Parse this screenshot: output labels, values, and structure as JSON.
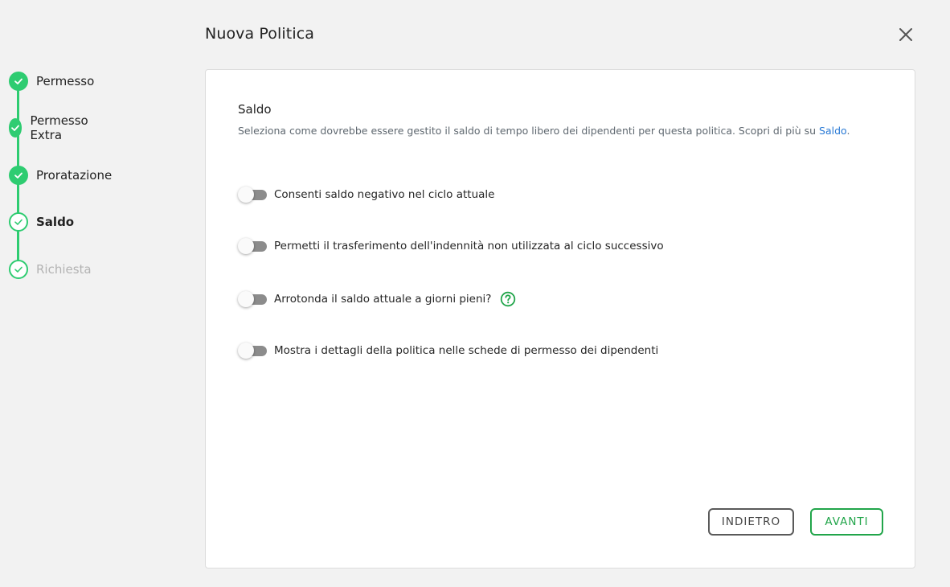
{
  "modal": {
    "title": "Nuova Politica",
    "close_icon": "close-icon"
  },
  "steps": [
    {
      "label": "Permesso",
      "state": "done"
    },
    {
      "label": "Permesso Extra",
      "state": "done"
    },
    {
      "label": "Proratazione",
      "state": "done"
    },
    {
      "label": "Saldo",
      "state": "active"
    },
    {
      "label": "Richiesta",
      "state": "pending"
    }
  ],
  "section": {
    "title": "Saldo",
    "description": "Seleziona come dovrebbe essere gestito il saldo di tempo libero dei dipendenti per questa politica. Scopri di più su",
    "link_label": "Saldo",
    "link_suffix": "."
  },
  "options": [
    {
      "label": "Consenti saldo negativo nel ciclo attuale",
      "enabled": false
    },
    {
      "label": "Permetti il trasferimento dell'indennità non utilizzata al ciclo successivo",
      "enabled": false
    },
    {
      "label": "Arrotonda il saldo attuale a giorni pieni?",
      "enabled": false,
      "help_icon": "question-circle-icon"
    },
    {
      "label": "Mostra i dettagli della politica nelle schede di permesso dei dipendenti",
      "enabled": false
    }
  ],
  "buttons": {
    "back_label": "INDIETRO",
    "next_label": "AVANTI"
  },
  "colors": {
    "accent_green": "#2ecc71",
    "button_green": "#21a54a",
    "link_blue": "#2a7ad5",
    "toggle_off": "#8c8c8c"
  }
}
